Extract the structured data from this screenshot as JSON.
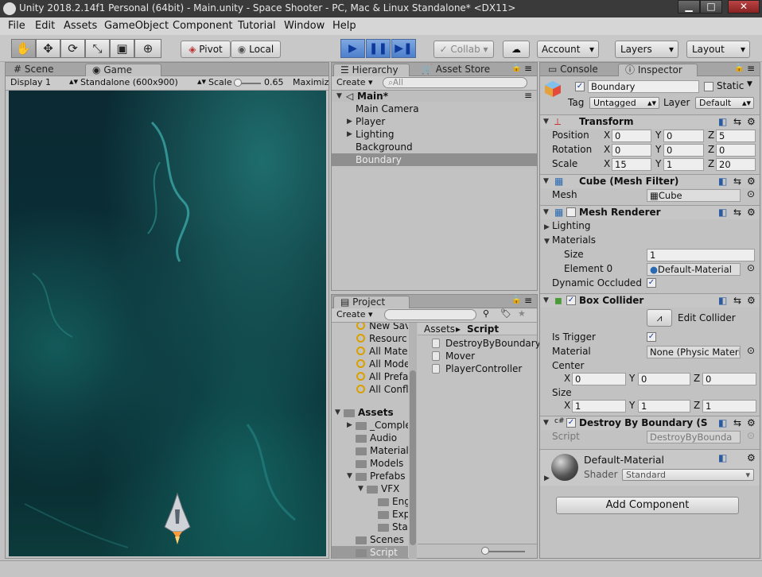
{
  "titlebar": {
    "title": "Unity 2018.2.14f1 Personal (64bit) - Main.unity - Space Shooter - PC, Mac & Linux Standalone* <DX11>",
    "min": "▁",
    "max": "□",
    "close": "✕"
  },
  "menu": [
    "File",
    "Edit",
    "Assets",
    "GameObject",
    "Component",
    "Tutorial",
    "Window",
    "Help"
  ],
  "toolbar": {
    "pivot": "Pivot",
    "local": "Local",
    "collab": "Collab ▾",
    "account": "Account",
    "layers": "Layers",
    "layout": "Layout"
  },
  "game_view": {
    "tab_scene": "Scene",
    "tab_game": "Game",
    "display": "Display 1",
    "resolution": "Standalone (600x900)",
    "scale_label": "Scale",
    "scale_value": "0.65",
    "maximize": "Maximize"
  },
  "hierarchy": {
    "tab": "Hierarchy",
    "tab_store": "Asset Store",
    "create": "Create",
    "search_placeholder": "All",
    "scene": "Main*",
    "items": [
      {
        "label": "Main Camera",
        "foldout": false,
        "selected": false
      },
      {
        "label": "Player",
        "foldout": true,
        "selected": false
      },
      {
        "label": "Lighting",
        "foldout": true,
        "selected": false
      },
      {
        "label": "Background",
        "foldout": false,
        "selected": false
      },
      {
        "label": "Boundary",
        "foldout": false,
        "selected": true
      }
    ]
  },
  "project": {
    "tab": "Project",
    "create": "Create",
    "favorites": [
      "New Sav",
      "Resourc",
      "All Mate",
      "All Mode",
      "All Prefa",
      "All Confl"
    ],
    "assets_label": "Assets",
    "tree": [
      {
        "label": "_Comple",
        "depth": 1,
        "foldout": true
      },
      {
        "label": "Audio",
        "depth": 1,
        "foldout": false
      },
      {
        "label": "Materials",
        "depth": 1,
        "foldout": false
      },
      {
        "label": "Models",
        "depth": 1,
        "foldout": false
      },
      {
        "label": "Prefabs",
        "depth": 1,
        "foldout": true,
        "open": true
      },
      {
        "label": "VFX",
        "depth": 2,
        "foldout": true,
        "open": true
      },
      {
        "label": "Eng",
        "depth": 3,
        "foldout": false
      },
      {
        "label": "Exp",
        "depth": 3,
        "foldout": false
      },
      {
        "label": "Sta",
        "depth": 3,
        "foldout": false
      },
      {
        "label": "Scenes",
        "depth": 1,
        "foldout": false
      },
      {
        "label": "Script",
        "depth": 1,
        "foldout": false,
        "selected": true
      }
    ],
    "breadcrumb_root": "Assets",
    "breadcrumb_current": "Script",
    "files": [
      "DestroyByBoundary",
      "Mover",
      "PlayerController"
    ]
  },
  "inspector": {
    "tab_console": "Console",
    "tab_inspector": "Inspector",
    "object_name": "Boundary",
    "static_label": "Static",
    "tag_label": "Tag",
    "tag_value": "Untagged",
    "layer_label": "Layer",
    "layer_value": "Default",
    "transform": {
      "title": "Transform",
      "position_label": "Position",
      "position": [
        "0",
        "0",
        "5"
      ],
      "rotation_label": "Rotation",
      "rotation": [
        "0",
        "0",
        "0"
      ],
      "scale_label": "Scale",
      "scale": [
        "15",
        "1",
        "20"
      ]
    },
    "mesh_filter": {
      "title": "Cube (Mesh Filter)",
      "mesh_label": "Mesh",
      "mesh_value": "Cube"
    },
    "mesh_renderer": {
      "title": "Mesh Renderer",
      "lighting": "Lighting",
      "materials": "Materials",
      "size_label": "Size",
      "size_value": "1",
      "element_label": "Element 0",
      "element_value": "Default-Material",
      "occluded_label": "Dynamic Occluded"
    },
    "box_collider": {
      "title": "Box Collider",
      "edit_label": "Edit Collider",
      "trigger_label": "Is Trigger",
      "material_label": "Material",
      "material_value": "None (Physic Materi",
      "center_label": "Center",
      "center": [
        "0",
        "0",
        "0"
      ],
      "size_label": "Size",
      "size": [
        "1",
        "1",
        "1"
      ]
    },
    "script_comp": {
      "title": "Destroy By Boundary (S",
      "script_label": "Script",
      "script_value": "DestroyByBounda"
    },
    "material": {
      "name": "Default-Material",
      "shader_label": "Shader",
      "shader_value": "Standard"
    },
    "add_component": "Add Component",
    "axis": {
      "x": "X",
      "y": "Y",
      "z": "Z"
    }
  }
}
